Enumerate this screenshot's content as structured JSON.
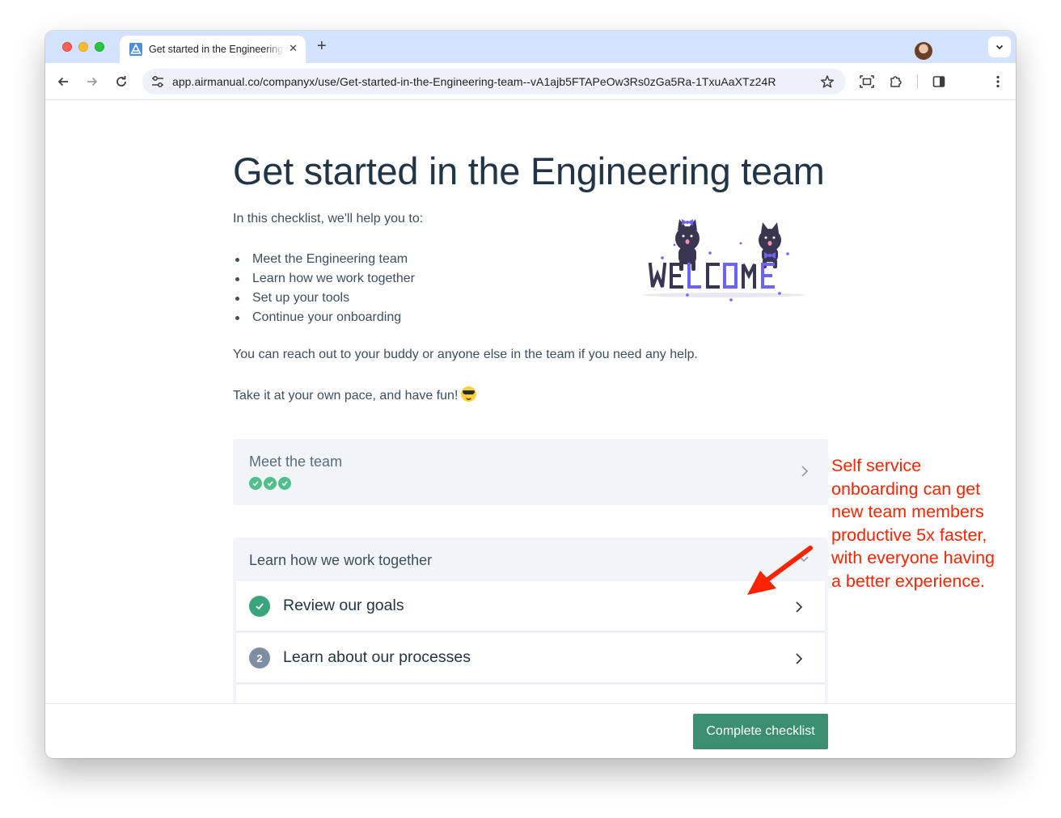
{
  "browser": {
    "tab_title": "Get started in the Engineering team",
    "tab_close": "✕",
    "new_tab": "+",
    "url": "app.airmanual.co/companyx/use/Get-started-in-the-Engineering-team--vA1ajb5FTAPeOw3Rs0zGa5Ra-1TxuAaXTz24R"
  },
  "page": {
    "title": "Get started in the Engineering team",
    "intro": "In this checklist, we'll help you to:",
    "bullets": [
      "Meet the Engineering team",
      "Learn how we work together",
      "Set up your tools",
      "Continue your onboarding"
    ],
    "reach_out": "You can reach out to your buddy or anyone else in the team if you need any help.",
    "pace": "Take it at your own pace, and have fun!",
    "pace_emoji": "sunglasses-emoji",
    "welcome_image": {
      "text": "WELCOME",
      "colors": {
        "dark": "#3a3550",
        "accent": "#6c63ff"
      }
    }
  },
  "sections": [
    {
      "title": "Meet the team",
      "completed_steps": 3,
      "state": "collapsed"
    },
    {
      "title": "Learn how we work together",
      "state": "expanded",
      "items": [
        {
          "badge": "✓",
          "label": "Review our goals",
          "done": true
        },
        {
          "badge": "2",
          "label": "Learn about our processes",
          "done": false
        }
      ]
    }
  ],
  "footer": {
    "complete_button": "Complete checklist"
  },
  "annotation": {
    "lines": [
      "Self service",
      "onboarding can get",
      "new team members",
      "productive 5x faster,",
      "with everyone having",
      "a better experience."
    ],
    "color": "#ff2200"
  },
  "colors": {
    "accent_green": "#3b8e6f",
    "check_green": "#4fc08d",
    "heading": "#213547",
    "tabbar": "#d3e3fd"
  }
}
